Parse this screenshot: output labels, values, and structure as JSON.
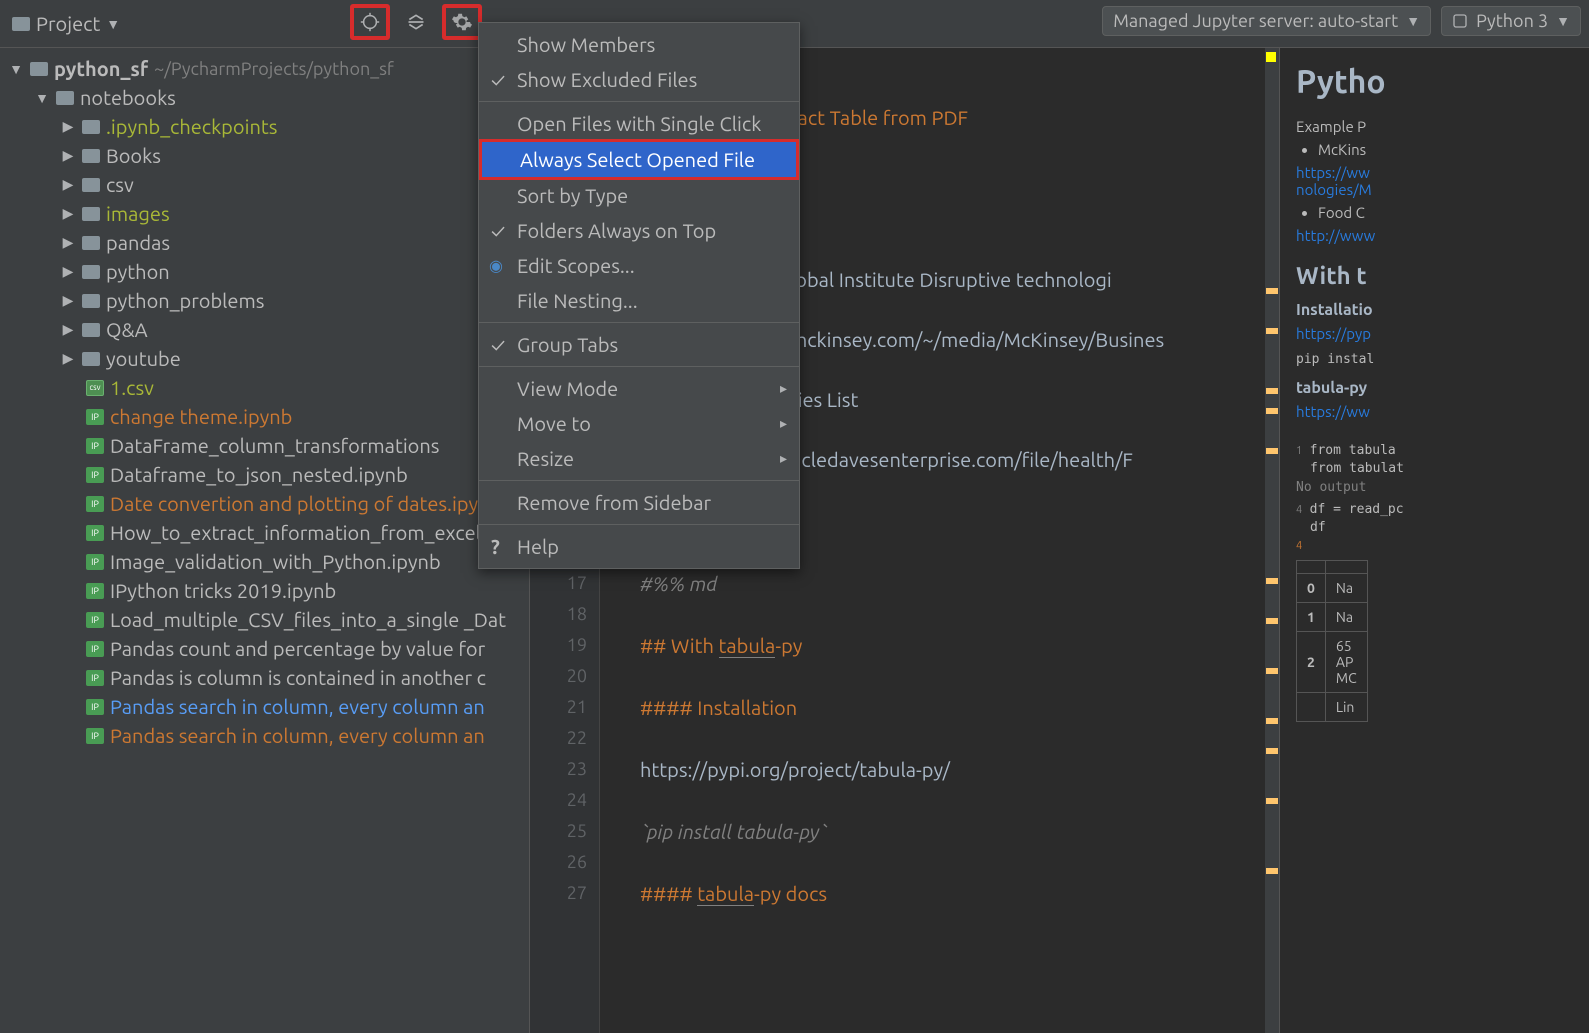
{
  "toolbar": {
    "project_label": "Project",
    "jupyter_label": "Managed Jupyter server: auto-start",
    "python_label": "Python 3"
  },
  "tree": {
    "root_name": "python_sf",
    "root_path": "~/PycharmProjects/python_sf",
    "notebooks_label": "notebooks",
    "folders": [
      {
        "name": ".ipynb_checkpoints",
        "style": "yellow"
      },
      {
        "name": "Books",
        "style": "white"
      },
      {
        "name": "csv",
        "style": "white"
      },
      {
        "name": "images",
        "style": "yellow"
      },
      {
        "name": "pandas",
        "style": "white"
      },
      {
        "name": "python",
        "style": "white"
      },
      {
        "name": "python_problems",
        "style": "white"
      },
      {
        "name": "Q&A",
        "style": "white"
      },
      {
        "name": "youtube",
        "style": "white"
      }
    ],
    "files": [
      {
        "name": "1.csv",
        "style": "yellow",
        "icon": "csv"
      },
      {
        "name": "change theme.ipynb",
        "style": "orange",
        "icon": "ipynb"
      },
      {
        "name": "DataFrame_column_transformations",
        "style": "white",
        "icon": "ipynb"
      },
      {
        "name": "Dataframe_to_json_nested.ipynb",
        "style": "white",
        "icon": "ipynb"
      },
      {
        "name": "Date convertion and plotting of dates.ipynb",
        "style": "orange",
        "icon": "ipynb"
      },
      {
        "name": "How_to_extract_information_from_excel_w",
        "style": "white",
        "icon": "ipynb"
      },
      {
        "name": "Image_validation_with_Python.ipynb",
        "style": "white",
        "icon": "ipynb"
      },
      {
        "name": "IPython tricks 2019.ipynb",
        "style": "white",
        "icon": "ipynb"
      },
      {
        "name": "Load_multiple_CSV_files_into_a_single _Dat",
        "style": "white",
        "icon": "ipynb"
      },
      {
        "name": "Pandas count and percentage by value for",
        "style": "white",
        "icon": "ipynb"
      },
      {
        "name": "Pandas is column is contained in another c",
        "style": "white",
        "icon": "ipynb"
      },
      {
        "name": "Pandas search in column, every column an",
        "style": "blue",
        "icon": "ipynb"
      },
      {
        "name": "Pandas search in column, every column an",
        "style": "orange",
        "icon": "ipynb"
      }
    ]
  },
  "menu": {
    "show_members": "Show Members",
    "show_excluded": "Show Excluded Files",
    "open_single": "Open Files with Single Click",
    "always_select": "Always Select Opened File",
    "sort_type": "Sort by Type",
    "folders_top": "Folders Always on Top",
    "edit_scopes": "Edit Scopes...",
    "file_nesting": "File Nesting...",
    "group_tabs": "Group Tabs",
    "view_mode": "View Mode",
    "move_to": "Move to",
    "resize": "Resize",
    "remove_sidebar": "Remove from Sidebar",
    "help": "Help"
  },
  "editor": {
    "line_start": 17,
    "text_partial_1": "ract Table from PDF",
    "text_partial_2": "lobal Institute Disruptive technologi",
    "text_partial_3": "mckinsey.com/~/media/McKinsey/Busines",
    "text_partial_4": "ries List",
    "text_partial_5": "ncledavesenterprise.com/file/health/F",
    "lines": [
      {
        "n": 17,
        "content": "#%% md",
        "cls": "cmt"
      },
      {
        "n": 18,
        "content": ""
      },
      {
        "n": 19,
        "content": "## With tabula-py",
        "parts": [
          {
            "t": "## With ",
            "c": "hdr"
          },
          {
            "t": "tabula",
            "c": "hdr uline"
          },
          {
            "t": "-py",
            "c": "hdr"
          }
        ]
      },
      {
        "n": 20,
        "content": ""
      },
      {
        "n": 21,
        "content": "#### Installation",
        "cls": "hdr"
      },
      {
        "n": 22,
        "content": ""
      },
      {
        "n": 23,
        "content": "https://pypi.org/project/tabula-py/"
      },
      {
        "n": 24,
        "content": ""
      },
      {
        "n": 25,
        "content": "`pip install tabula-py`",
        "cls": "cmt"
      },
      {
        "n": 26,
        "content": ""
      },
      {
        "n": 27,
        "content": "#### tabula-py docs",
        "parts": [
          {
            "t": "#### ",
            "c": "hdr"
          },
          {
            "t": "tabula",
            "c": "hdr uline"
          },
          {
            "t": "-py docs",
            "c": "hdr"
          }
        ]
      }
    ]
  },
  "preview": {
    "title": "Pytho",
    "example_label": "Example P",
    "bullet1": "McKins",
    "link1": "https://ww",
    "link1b": "nologies/M",
    "bullet2": "Food C",
    "link2": "http://www",
    "with_t": "With t",
    "install_h": "Installatio",
    "link3": "https://pyp",
    "pip_line": "pip instal",
    "tabula_h": "tabula-py",
    "link4": "https://ww",
    "code1": "from tabula",
    "code2": "from tabulat",
    "nooutput": "No output",
    "code3": "df = read_pc",
    "code4": "df",
    "th0": "0",
    "th1": "1",
    "th2": "2",
    "tdNa": "Na",
    "td65": "65",
    "tdAP": "AP",
    "tdMC": "MC",
    "tdLi": "Lin",
    "cell1": "1",
    "cell4": "4",
    "err4": "4"
  }
}
